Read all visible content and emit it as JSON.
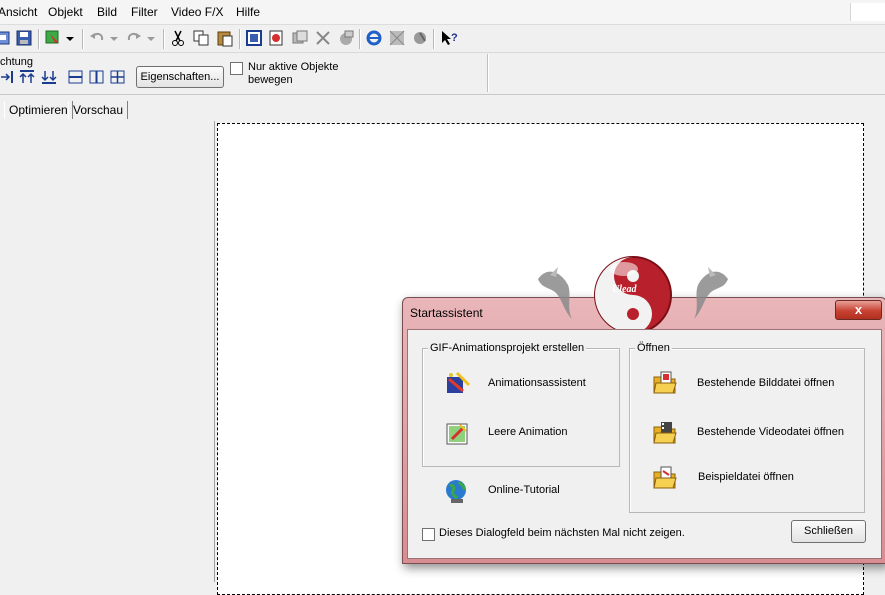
{
  "menu": {
    "items": [
      "Ansicht",
      "Objekt",
      "Bild",
      "Filter",
      "Video F/X",
      "Hilfe"
    ]
  },
  "optbar": {
    "label_fragment": "chtung",
    "properties_button": "Eigenschaften...",
    "active_only_line1": "Nur aktive Objekte",
    "active_only_line2": "bewegen",
    "active_only_checked": false
  },
  "tabs": [
    "Optimieren",
    "Vorschau"
  ],
  "dialog": {
    "title": "Startassistent",
    "close_glyph": "x",
    "logo_text": "Ulead",
    "group_create": {
      "legend": "GIF-Animationsprojekt erstellen",
      "items": [
        {
          "label": "Animationsassistent",
          "icon": "wand-icon"
        },
        {
          "label": "Leere Animation",
          "icon": "blank-animation-icon"
        }
      ]
    },
    "tutorial": {
      "label": "Online-Tutorial",
      "icon": "globe-icon"
    },
    "group_open": {
      "legend": "Öffnen",
      "items": [
        {
          "label": "Bestehende Bilddatei öffnen",
          "icon": "open-image-folder-icon"
        },
        {
          "label": "Bestehende Videodatei öffnen",
          "icon": "open-video-folder-icon"
        },
        {
          "label": "Beispieldatei öffnen",
          "icon": "open-sample-folder-icon"
        }
      ]
    },
    "dont_show_label": "Dieses Dialogfeld beim nächsten Mal nicht zeigen.",
    "dont_show_checked": false,
    "close_button": "Schließen"
  },
  "colors": {
    "dialog_frame": "#d78d92",
    "close_red": "#c74232",
    "canvas": "#ffffff"
  }
}
